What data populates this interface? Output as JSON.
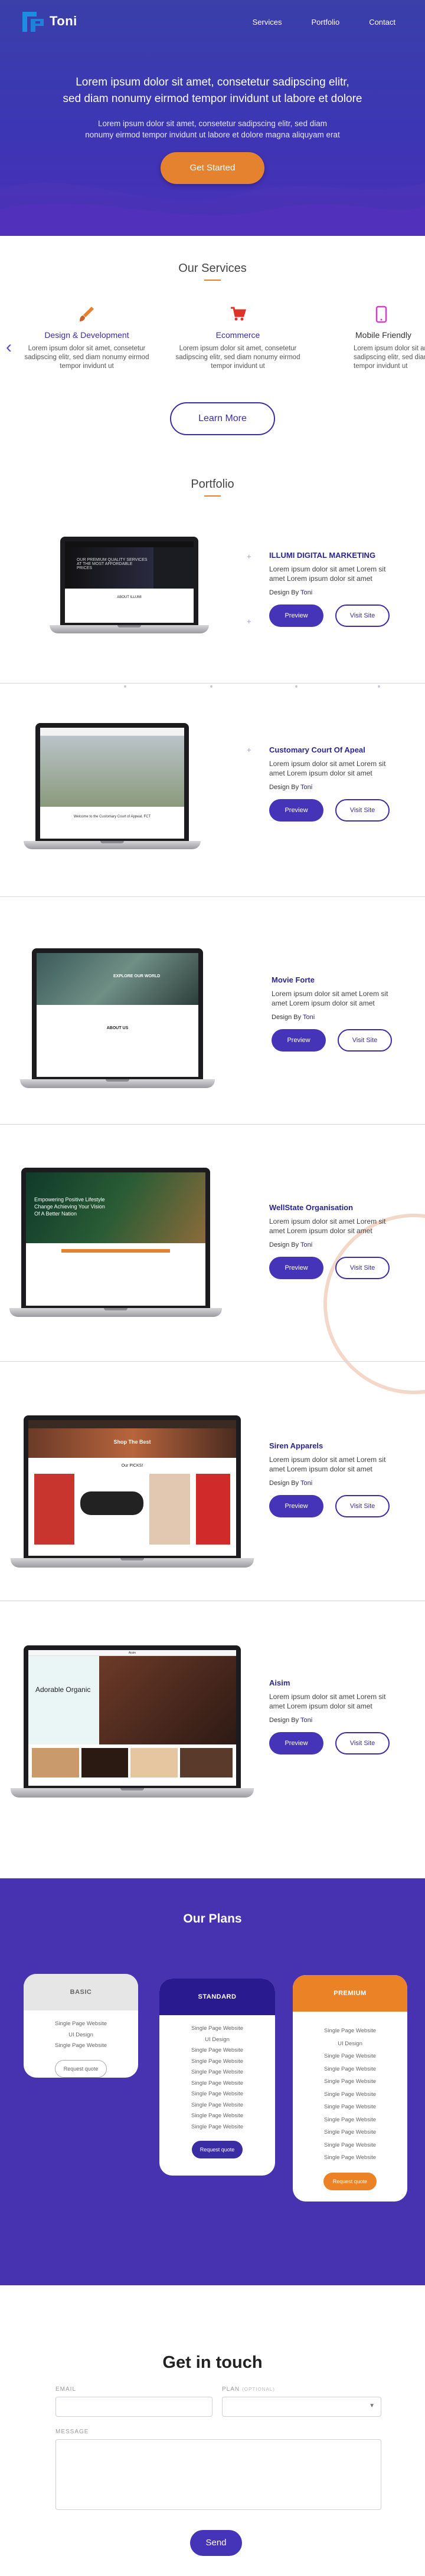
{
  "brand": {
    "name": "Toni",
    "accent": "#3c36b4",
    "orange": "#e4822f"
  },
  "nav": {
    "items": [
      "Services",
      "Portfolio",
      "Contact"
    ]
  },
  "hero": {
    "title_line1": "Lorem ipsum dolor sit amet, consetetur sadipscing elitr,",
    "title_line2": "sed diam nonumy eirmod tempor invidunt ut labore et dolore",
    "sub_line1": "Lorem ipsum dolor sit amet, consetetur sadipscing elitr, sed diam",
    "sub_line2": "nonumy eirmod tempor invidunt ut labore et dolore magna aliquyam erat",
    "cta": "Get Started"
  },
  "services": {
    "title": "Our Services",
    "items": [
      {
        "icon": "paintbrush-icon",
        "title": "Design & Development",
        "title_color": "#3a2ca3",
        "desc_line1": "Lorem ipsum dolor sit amet, consetetur",
        "desc_line2": "sadipscing elitr, sed diam nonumy eirmod",
        "desc_line3": "tempor invidunt ut"
      },
      {
        "icon": "cart-icon",
        "title": "Ecommerce",
        "title_color": "#3a2ca3",
        "desc_line1": "Lorem ipsum dolor sit amet, consetetur",
        "desc_line2": "sadipscing elitr, sed diam nonumy eirmod",
        "desc_line3": "tempor invidunt ut"
      },
      {
        "icon": "phone-icon",
        "title": "Mobile Friendly",
        "title_color": "#3a2ca3",
        "desc_line1": "Lorem ipsum dolor sit amet, con",
        "desc_line2": "sadipscing elitr, sed diam nonu",
        "desc_line3": "tempor invidunt ut"
      }
    ],
    "learn_more": "Learn More"
  },
  "portfolio": {
    "title": "Portfolio",
    "preview_label": "Preview",
    "visit_label": "Visit Site",
    "design_prefix": "Design By",
    "designer": "Toni",
    "items": [
      {
        "name": "ILLUMI DIGITAL MARKETING",
        "desc": "Lorem ipsum dolor sit amet Lorem sit amet Lorem ipsum dolor sit amet",
        "screen_text": "OUR PREMIUM QUALITY SERVICES AT THE MOST AFFORDABLE PRICES",
        "screen_sub": "ABOUT ILLUMI"
      },
      {
        "name": "Customary Court Of Apeal",
        "desc": "Lorem ipsum dolor sit amet Lorem sit amet Lorem ipsum dolor sit amet",
        "screen_text": "Welcome to the Customary Court of Appeal, FCT",
        "screen_sub": ""
      },
      {
        "name": "Movie Forte",
        "desc": "Lorem ipsum dolor sit amet Lorem sit amet Lorem ipsum dolor sit amet",
        "screen_text": "EXPLORE OUR WORLD",
        "screen_sub": "ABOUT US"
      },
      {
        "name": "WellState Organisation",
        "desc": "Lorem ipsum dolor sit amet Lorem sit amet Lorem ipsum dolor sit amet",
        "screen_text": "Empowering Positive Lifestyle Change Achieving Your Vision Of A Better Nation",
        "screen_sub": ""
      },
      {
        "name": "Siren Apparels",
        "desc": "Lorem ipsum dolor sit amet Lorem sit amet Lorem ipsum dolor sit amet",
        "screen_text": "Shop The Best",
        "screen_sub": "Our PICKS!"
      },
      {
        "name": "Aisim",
        "desc": "Lorem ipsum dolor sit amet Lorem sit amet Lorem ipsum dolor sit amet",
        "screen_text": "Adorable Organic",
        "screen_sub": "Aisim"
      }
    ]
  },
  "plans": {
    "title": "Our Plans",
    "basic": {
      "name": "BASIC",
      "features": [
        "Single Page Website",
        "UI Design",
        "Single Page Website"
      ],
      "cta": "Request quote"
    },
    "standard": {
      "name": "STANDARD",
      "features": [
        "Single Page Website",
        "UI Design",
        "Single Page Website",
        "Single Page Website",
        "Single Page Website",
        "Single Page Website",
        "Single Page Website",
        "Single Page Website",
        "Single Page Website",
        "Single Page Website"
      ],
      "cta": "Request quote"
    },
    "premium": {
      "name": "PREMIUM",
      "features": [
        "Single Page Website",
        "UI Design",
        "Single Page Website",
        "Single Page Website",
        "Single Page Website",
        "Single Page Website",
        "Single Page Website",
        "Single Page Website",
        "Single Page Website",
        "Single Page Website",
        "Single Page Website"
      ],
      "cta": "Request quote"
    }
  },
  "contact": {
    "title": "Get in touch",
    "email_label": "EMAIL",
    "plan_label": "PLAN",
    "plan_optional": "(OPTIONAL)",
    "message_label": "MESSAGE",
    "send": "Send"
  }
}
